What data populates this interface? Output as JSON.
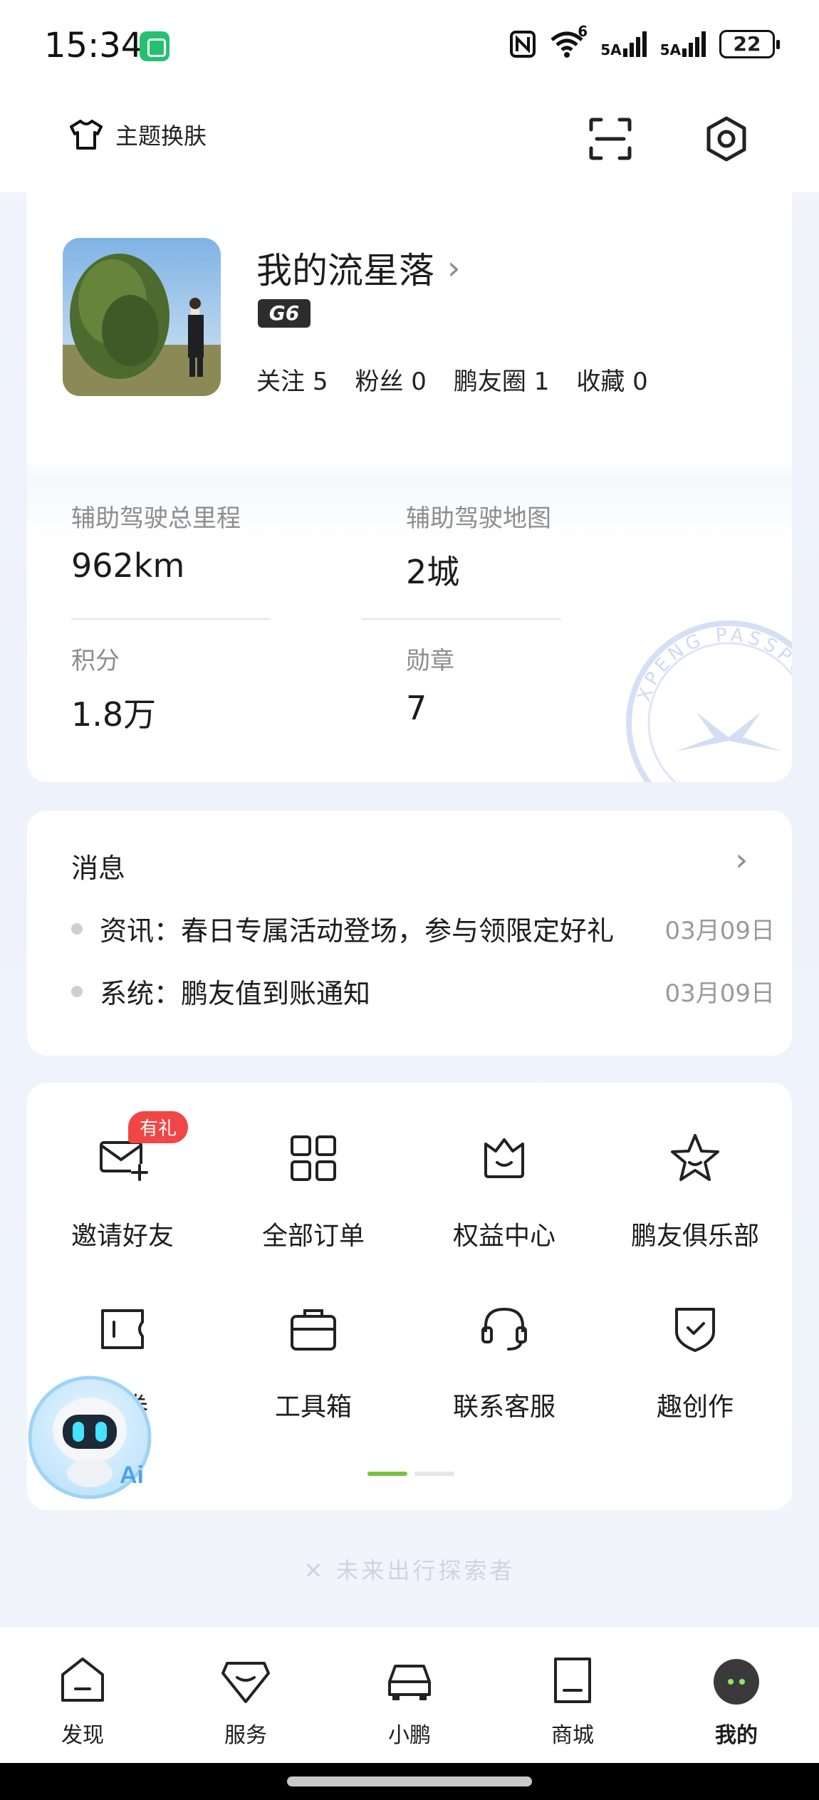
{
  "status_bar": {
    "time": "15:34",
    "signal1": "5A",
    "signal2": "5A",
    "wifi_sup": "6",
    "battery": "22"
  },
  "top_bar": {
    "theme_label": "主题换肤"
  },
  "profile": {
    "name": "我的流星落",
    "car_badge": "G6",
    "stats": [
      {
        "label": "关注",
        "value": "5"
      },
      {
        "label": "粉丝",
        "value": "0"
      },
      {
        "label": "鹏友圈",
        "value": "1"
      },
      {
        "label": "收藏",
        "value": "0"
      }
    ],
    "metrics": [
      {
        "label": "辅助驾驶总里程",
        "value": "962km"
      },
      {
        "label": "辅助驾驶地图",
        "value": "2城"
      },
      {
        "label": "积分",
        "value": "1.8万"
      },
      {
        "label": "勋章",
        "value": "7"
      }
    ],
    "passport_text": "XPENG PASSPORT"
  },
  "messages": {
    "title": "消息",
    "items": [
      {
        "text": "资讯：春日专属活动登场，参与领限定好礼",
        "date": "03月09日"
      },
      {
        "text": "系统：鹏友值到账通知",
        "date": "03月09日"
      }
    ]
  },
  "services": {
    "gift_badge": "有礼",
    "items": [
      {
        "label": "邀请好友",
        "icon": "invite-mail-icon"
      },
      {
        "label": "全部订单",
        "icon": "grid-orders-icon"
      },
      {
        "label": "权益中心",
        "icon": "benefits-icon"
      },
      {
        "label": "鹏友俱乐部",
        "icon": "star-club-icon"
      },
      {
        "label": "卡券",
        "icon": "coupon-icon"
      },
      {
        "label": "工具箱",
        "icon": "toolbox-icon"
      },
      {
        "label": "联系客服",
        "icon": "headset-icon"
      },
      {
        "label": "趣创作",
        "icon": "shield-check-icon"
      }
    ],
    "active_page": 1,
    "page_count": 2
  },
  "ai_assistant": {
    "label": "Ai"
  },
  "slogan": "未来出行探索者",
  "tabbar": {
    "items": [
      {
        "label": "发现",
        "icon": "discover-icon"
      },
      {
        "label": "服务",
        "icon": "service-icon"
      },
      {
        "label": "小鹏",
        "icon": "car-icon"
      },
      {
        "label": "商城",
        "icon": "shop-icon"
      },
      {
        "label": "我的",
        "icon": "me-avatar-icon",
        "active": true
      }
    ]
  },
  "colors": {
    "accent_green": "#7ac143",
    "badge_red": "#f04646",
    "bg": "#f3f5fb"
  }
}
